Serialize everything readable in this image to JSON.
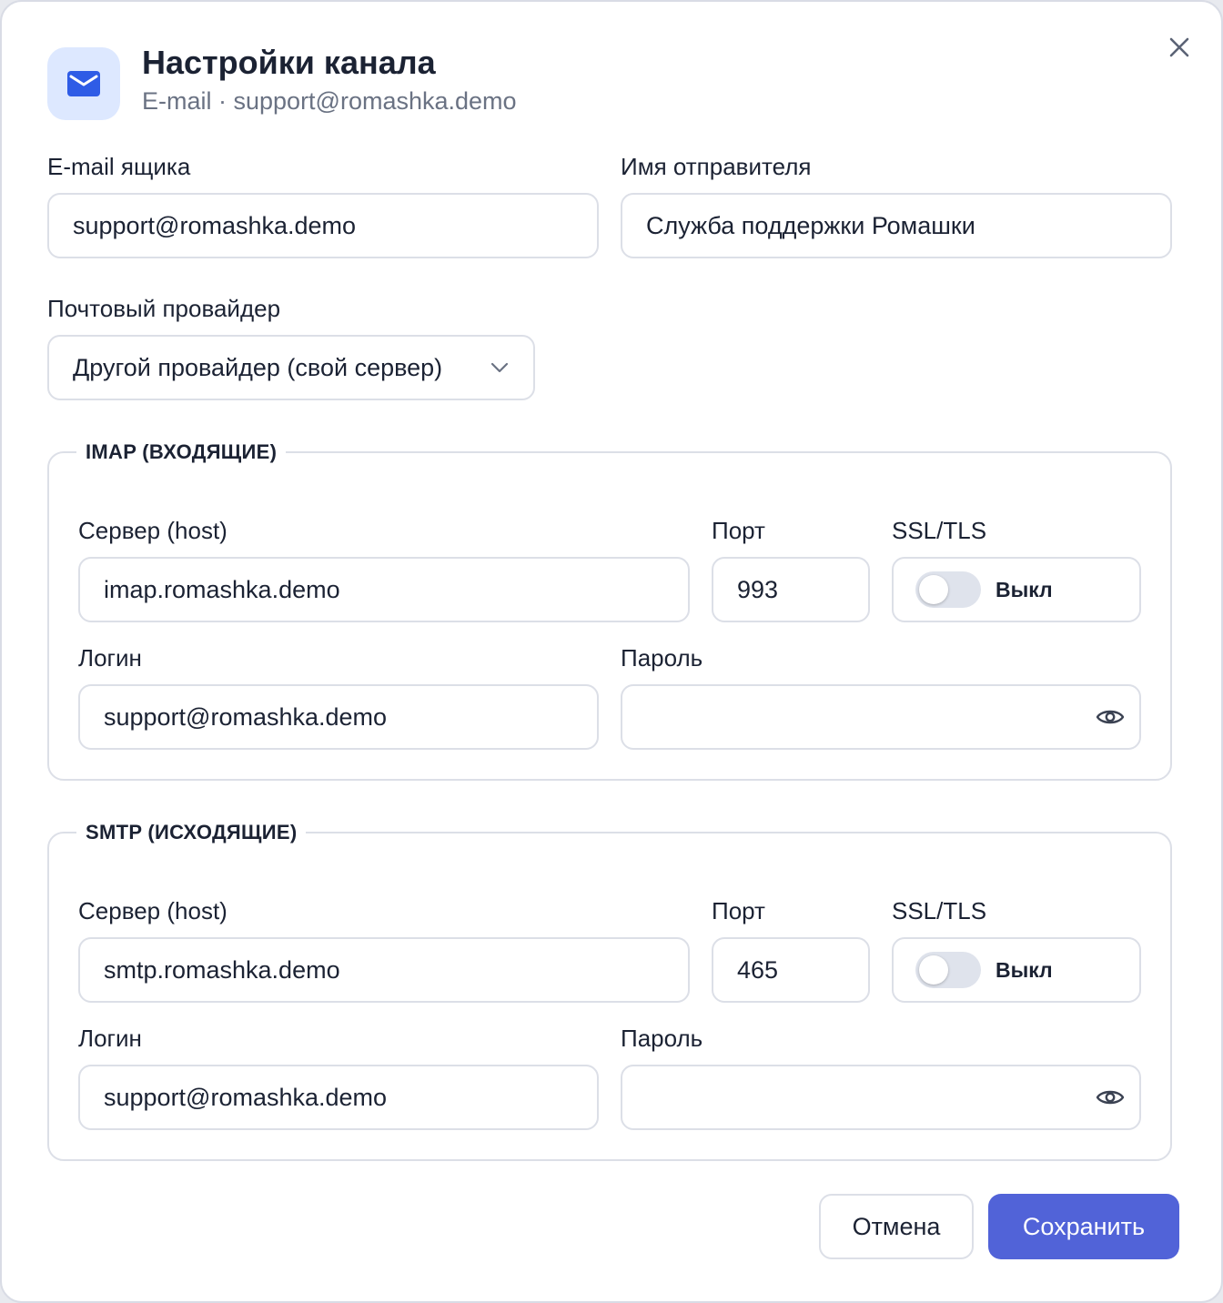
{
  "header": {
    "title": "Настройки канала",
    "subtitle": "E-mail · support@romashka.demo",
    "icon": "mail-icon",
    "accent": "#2f5ce6"
  },
  "form": {
    "mailbox_label": "E-mail ящика",
    "mailbox_value": "support@romashka.demo",
    "sender_label": "Имя отправителя",
    "sender_value": "Служба поддержки Ромашки",
    "provider_label": "Почтовый провайдер",
    "provider_value": "Другой провайдер (свой сервер)"
  },
  "imap": {
    "legend": "IMAP (ВХОДЯЩИЕ)",
    "host_label": "Сервер (host)",
    "host_value": "imap.romashka.demo",
    "port_label": "Порт",
    "port_value": "993",
    "ssl_label": "SSL/TLS",
    "ssl_state": "Выкл",
    "ssl_enabled": false,
    "login_label": "Логин",
    "login_value": "support@romashka.demo",
    "password_label": "Пароль",
    "password_value": ""
  },
  "smtp": {
    "legend": "SMTP (ИСХОДЯЩИЕ)",
    "host_label": "Сервер (host)",
    "host_value": "smtp.romashka.demo",
    "port_label": "Порт",
    "port_value": "465",
    "ssl_label": "SSL/TLS",
    "ssl_state": "Выкл",
    "ssl_enabled": false,
    "login_label": "Логин",
    "login_value": "support@romashka.demo",
    "password_label": "Пароль",
    "password_value": ""
  },
  "actions": {
    "cancel_label": "Отмена",
    "save_label": "Сохранить",
    "save_color": "#5163d8"
  }
}
